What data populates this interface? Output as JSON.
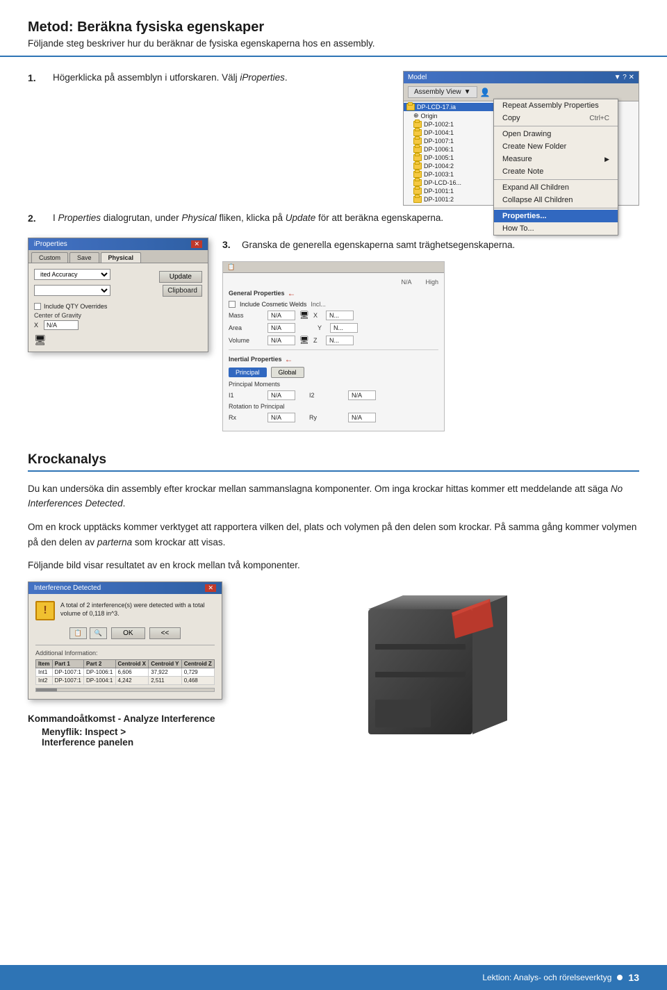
{
  "header": {
    "title": "Metod: Beräkna fysiska egenskaper",
    "subtitle": "Följande steg beskriver hur du beräknar de fysiska egenskaperna hos en assembly."
  },
  "step1": {
    "number": "1.",
    "text": "Högerklicka på assemblyn i utforskaren. Välj ",
    "italic": "iProperties",
    "text2": "."
  },
  "step2": {
    "number": "2.",
    "text": "I ",
    "italic1": "Properties",
    "text2": " dialogrutan, under ",
    "italic2": "Physical",
    "text3": " fliken, klicka på ",
    "italic3": "Update",
    "text4": " för att beräkna egenskaperna."
  },
  "step3": {
    "number": "3.",
    "text": "Granska de generella egenskaperna samt träghetsegenskaperna."
  },
  "assembly_view": {
    "title": "Model",
    "toolbar_tabs": [
      "Assembly View"
    ],
    "view_label": "Assembly View",
    "tree_items": [
      "DP-LCD-17.ia",
      "Origin",
      "DP-1002:1",
      "DP-1004:1",
      "DP-1007:1",
      "DP-1006:1",
      "DP-1005:1",
      "DP-1004:2",
      "DP-1003:1",
      "DP-LCD-16...",
      "DP-1001:1",
      "DP-1001:2"
    ],
    "context_menu": {
      "items": [
        {
          "label": "Repeat Assembly Properties",
          "shortcut": ""
        },
        {
          "label": "Copy",
          "shortcut": "Ctrl+C"
        },
        {
          "divider": true
        },
        {
          "label": "Open Drawing",
          "shortcut": ""
        },
        {
          "label": "Create New Folder",
          "shortcut": ""
        },
        {
          "label": "Measure",
          "shortcut": "",
          "arrow": true
        },
        {
          "label": "Create Note",
          "shortcut": ""
        },
        {
          "divider": true
        },
        {
          "label": "Expand All Children",
          "shortcut": ""
        },
        {
          "label": "Collapse All Children",
          "shortcut": ""
        },
        {
          "divider": true
        },
        {
          "label": "Properties...",
          "shortcut": "",
          "active": true
        },
        {
          "label": "How To...",
          "shortcut": ""
        }
      ]
    }
  },
  "dialog": {
    "title": "iProperties",
    "tabs": [
      "Custom",
      "Save",
      "Physical"
    ],
    "active_tab": "Physical",
    "accuracy_label": "ited Accuracy",
    "update_btn": "Update",
    "clipboard_label": "Clipboard",
    "include_qty_label": "Include QTY Overrides",
    "center_of_gravity": "Center of Gravity",
    "x_label": "X",
    "na_value": "N/A"
  },
  "properties_panel": {
    "na_label": "N/A",
    "high_label": "High",
    "general_props_label": "General Properties",
    "include_cosmetic_welds": "Include Cosmetic Welds",
    "incl_label": "Incl...",
    "mass_label": "Mass",
    "area_label": "Area",
    "volume_label": "Volume",
    "x_label": "X",
    "y_label": "Y",
    "z_label": "Z",
    "na": "N/A",
    "inertial_props_label": "Inertial Properties",
    "principal_btn": "Principal",
    "global_btn": "Global",
    "principal_moments": "Principal Moments",
    "i1_label": "I1",
    "i2_label": "I2",
    "rotation_label": "Rotation to Principal",
    "rx_label": "Rx",
    "ry_label": "Ry"
  },
  "krockanalys": {
    "heading": "Krockanalys",
    "para1": "Du kan undersöka din assembly efter krockar mellan sammanslagna komponenter. Om inga krockar hittas kommer ett meddelande att säga ",
    "para1_italic": "No Interferences Detected",
    "para1_end": ".",
    "para2": "Om en krock upptäcks kommer verktyget att rapportera vilken del, plats och volymen på den delen som krockar. På samma gång kommer volymen på den delen av ",
    "para2_italic": "parterna",
    "para2_end": " som krockar att visas.",
    "para3": "Följande bild visar resultatet av en krock mellan två komponenter."
  },
  "interference_dialog": {
    "title": "Interference Detected",
    "message": "A total of 2 interference(s) were detected with a total volume of 0,118 in^3.",
    "ok_btn": "OK",
    "back_btn": "<<",
    "additional_label": "Additional Information:",
    "table_headers": [
      "Item",
      "Part 1",
      "Part 2",
      "Centroid X",
      "Centroid Y",
      "Centroid Z"
    ],
    "table_rows": [
      [
        "Int1",
        "DP-1007:1",
        "DP-1006:1",
        "6,606",
        "37,922",
        "0,729"
      ],
      [
        "Int2",
        "DP-1007:1",
        "DP-1004:1",
        "4,242",
        "2,511",
        "0,468"
      ]
    ]
  },
  "kommando": {
    "label": "Kommandoåtkomst - Analyze Interference",
    "detail1": "Menyflik: ",
    "detail1_bold": "Inspect >",
    "detail2_bold": "Interference",
    "detail2": " panelen"
  },
  "footer": {
    "text": "Lektion: Analys- och rörelseverktyg",
    "page": "13"
  }
}
